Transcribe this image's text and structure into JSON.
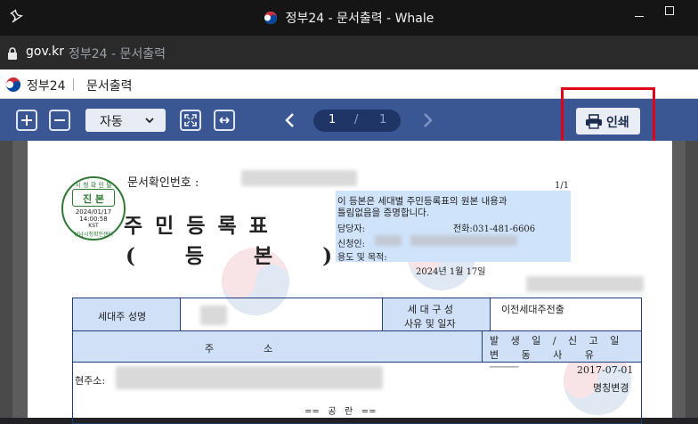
{
  "window": {
    "title": "정부24 - 문서출력 - Whale"
  },
  "address_bar": {
    "domain": "gov.kr",
    "page_title": "정부24 - 문서출력"
  },
  "site_header": {
    "site_name": "정부24",
    "doc_title": "문서출력"
  },
  "toolbar": {
    "zoom_value": "자동",
    "current_page": "1",
    "page_separator": "/",
    "total_pages": "1",
    "print_label": "인쇄"
  },
  "document": {
    "confirm_no_label": "문서확인번호 :",
    "page_indicator": "1/1",
    "seal": {
      "top_text": "시 청 확 인 필",
      "center_text": "진 본",
      "date": "2024/01/17",
      "time": "14:00:58",
      "tz": "KST",
      "bottom_text": "성남시청확인센터"
    },
    "title_line1": "주 민 등 록 표",
    "title_line2": "( 등 본 )",
    "cert_text_1": "이 등본은 세대별 주민등록표의 원본 내용과",
    "cert_text_2": "틀림없음을 증명합니다.",
    "manager_label": "담당자:",
    "phone_label": "전화:031-481-6606",
    "applicant_label": "신청인:",
    "purpose_label": "용도 및 목적:",
    "issue_date": "2024년 1월 17일",
    "table": {
      "head_label": "세대주 성명",
      "composition_label_1": "세 대 구 성",
      "composition_label_2": "사유 및 일자",
      "composition_value": "이전세대주전출",
      "address_header": "주                소",
      "occurrence_header_1": "발 생 일 / 신 고 일",
      "occurrence_header_2": "변 동 사 유",
      "current_address_label": "현주소:",
      "dash_line": "──────",
      "change_date": "2017-07-01",
      "change_reason": "명칭변경",
      "blank_label": "==   공   란   =="
    }
  },
  "colors": {
    "toolbar": "#3a5794",
    "highlight": "#cfe3fb",
    "table_border": "#1f3b7a",
    "table_header": "#cfe0f7",
    "seal": "#2f7a35",
    "red_annotation": "#e0001a"
  }
}
